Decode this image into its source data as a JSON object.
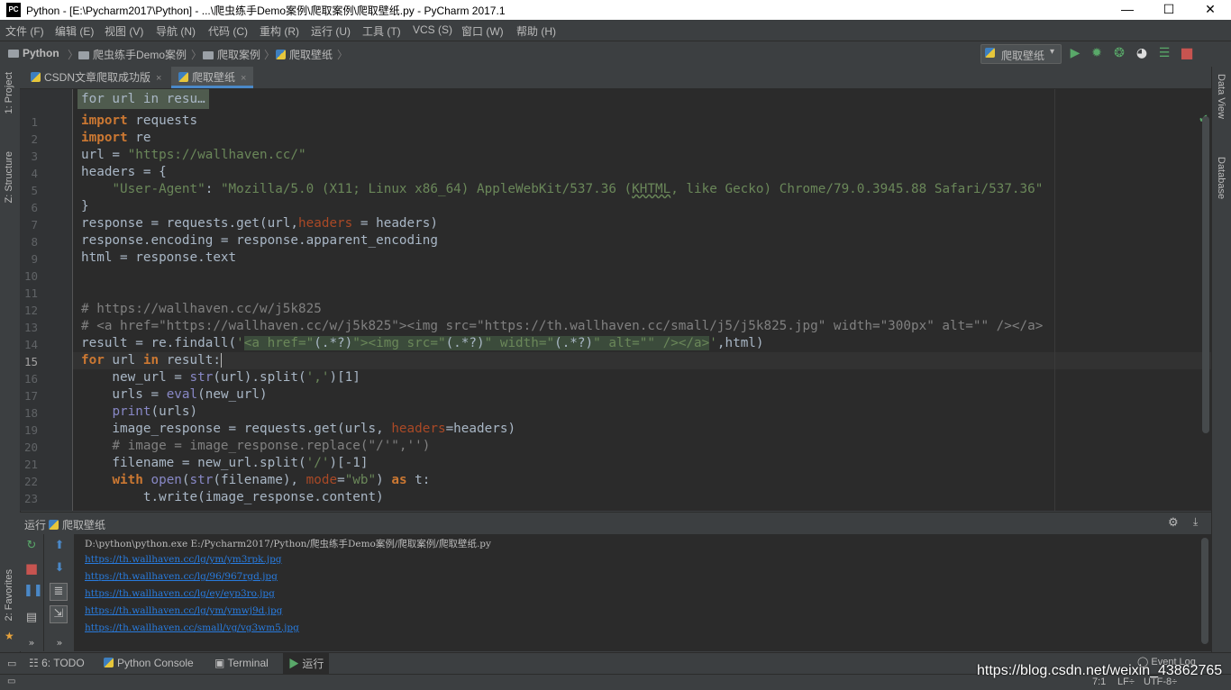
{
  "window": {
    "app_badge": "PC",
    "title": "Python - [E:\\Pycharm2017\\Python] - ...\\爬虫练手Demo案例\\爬取案例\\爬取壁纸.py - PyCharm 2017.1",
    "minimize": "—",
    "maximize": "☐",
    "close": "✕"
  },
  "menu": [
    "文件 (F)",
    "编辑 (E)",
    "视图 (V)",
    "导航 (N)",
    "代码 (C)",
    "重构 (R)",
    "运行 (U)",
    "工具 (T)",
    "VCS (S)",
    "窗口 (W)",
    "帮助 (H)"
  ],
  "breadcrumb": {
    "project": "Python",
    "folder1": "爬虫练手Demo案例",
    "folder2": "爬取案例",
    "file": "爬取壁纸"
  },
  "run_config": {
    "label": "爬取壁纸",
    "arrow": "▾"
  },
  "toolbar_icons": [
    "run-icon",
    "debug-icon",
    "coverage-icon",
    "profile-icon",
    "concurrency-icon",
    "stop-icon"
  ],
  "left_strip": {
    "project": "1: Project",
    "structure": "Z: Structure",
    "favorites": "2: Favorites"
  },
  "right_strip": {
    "data_view": "Data View",
    "database": "Database"
  },
  "tabs": [
    {
      "label": "CSDN文章爬取成功版",
      "close": "×"
    },
    {
      "label": "爬取壁纸",
      "close": "×"
    }
  ],
  "editor": {
    "sticky_hint": "for url in resu…",
    "current_line": 15,
    "line_numbers": [
      "1",
      "2",
      "3",
      "4",
      "5",
      "6",
      "7",
      "8",
      "9",
      "10",
      "11",
      "12",
      "13",
      "14",
      "15",
      "16",
      "17",
      "18",
      "19",
      "20",
      "21",
      "22",
      "23"
    ]
  },
  "code": {
    "l1_kw": "import",
    "l1_rest": " requests",
    "l2_kw": "import",
    "l2_rest": " re",
    "l3_a": "url = ",
    "l3_str": "\"https://wallhaven.cc/\"",
    "l4": "headers = {",
    "l5_indent": "    ",
    "l5_key": "\"User-Agent\"",
    "l5_colon": ": ",
    "l5_v1": "\"Mozilla/5.0 (X11; Linux x86_64) AppleWebKit/537.36 (",
    "l5_v2": "KHTML",
    "l5_v3": ", like Gecko) Chrome/79.0.3945.88 Safari/537.36\"",
    "l6": "}",
    "l7_a": "response = requests.get(url,",
    "l7_prm": "headers",
    "l7_b": " = headers)",
    "l8": "response.encoding = response.apparent_encoding",
    "l9": "html = response.text",
    "l12": "# https://wallhaven.cc/w/j5k825",
    "l13": "# <a href=\"https://wallhaven.cc/w/j5k825\"><img src=\"https://th.wallhaven.cc/small/j5/j5k825.jpg\" width=\"300px\" alt=\"\" /></a>",
    "l14_a": "result = re.findall(",
    "l14_q1": "'",
    "l14_p1": "<a href=\"",
    "l14_g1": "(.*?)",
    "l14_p2": "\"><img src=\"",
    "l14_g2": "(.*?)",
    "l14_p3": "\" width=\"",
    "l14_g3": "(.*?)",
    "l14_p4": "\" alt=\"\" /></a>",
    "l14_q2": "'",
    "l14_b": ",html)",
    "l15_kw1": "for",
    "l15_a": " url ",
    "l15_kw2": "in",
    "l15_b": " result:",
    "l16_a": "    new_url = ",
    "l16_bi": "str",
    "l16_b": "(url).split(",
    "l16_str": "','",
    "l16_c": ")[1]",
    "l17_a": "    urls = ",
    "l17_bi": "eval",
    "l17_b": "(new_url)",
    "l18_a": "    ",
    "l18_bi": "print",
    "l18_b": "(urls)",
    "l19_a": "    image_response = requests.get(urls, ",
    "l19_prm": "headers",
    "l19_b": "=headers)",
    "l20": "    # image = image_response.replace(\"/'\",'')",
    "l21_a": "    filename = new_url.split(",
    "l21_str": "'/'",
    "l21_b": ")[-1]",
    "l22_a": "    ",
    "l22_kw": "with",
    "l22_sp": " ",
    "l22_bi1": "open",
    "l22_b": "(",
    "l22_bi2": "str",
    "l22_c": "(filename), ",
    "l22_prm": "mode",
    "l22_eq": "=",
    "l22_str": "\"wb\"",
    "l22_d": ") ",
    "l22_kw2": "as",
    "l22_e": " t:",
    "l23": "        t.write(image_response.content)"
  },
  "run_panel": {
    "label": "运行",
    "config": "爬取壁纸",
    "command": "D:\\python\\python.exe E:/Pycharm2017/Python/爬虫练手Demo案例/爬取案例/爬取壁纸.py",
    "output_links": [
      "https://th.wallhaven.cc/lg/ym/ym3rpk.jpg",
      "https://th.wallhaven.cc/lg/96/967rgd.jpg",
      "https://th.wallhaven.cc/lg/ey/eyp3ro.jpg",
      "https://th.wallhaven.cc/lg/ym/ymwj9d.jpg",
      "https://th.wallhaven.cc/small/vg/vg3wm5.jpg"
    ]
  },
  "bottom_tabs": {
    "todo": "6: TODO",
    "python_console": "Python Console",
    "terminal": "Terminal",
    "run": "运行",
    "event_log": "Event Log"
  },
  "status": {
    "position": "7:1",
    "line_sep": "LF÷",
    "encoding": "UTF-8÷"
  },
  "watermark": "https://blog.csdn.net/weixin_43862765",
  "colors": {
    "keyword": "#cc7832",
    "string": "#6a8759",
    "comment": "#808080",
    "background": "#2b2b2b",
    "link": "#287bde"
  }
}
